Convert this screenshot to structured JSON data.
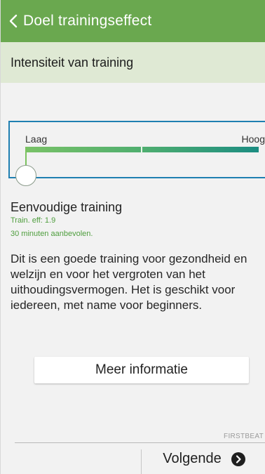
{
  "header": {
    "title": "Doel trainingseffect",
    "back_icon": "chevron-left-icon",
    "color": "#6aa84f"
  },
  "subheader": {
    "text": "Intensiteit van training",
    "color": "#dfe9d4"
  },
  "slider": {
    "low_label": "Laag",
    "high_label": "Hoog",
    "level": 0.0,
    "accent": "#1f7fb1"
  },
  "result": {
    "title": "Eenvoudige training",
    "effect": "Train. eff: 1.9",
    "recommendation": "30 minuten aanbevolen.",
    "description": "Dit is een goede training voor gezondheid en welzijn en voor het vergroten van het uithoudingsvermogen. Het is geschikt voor iedereen, met name voor beginners.",
    "accent": "#4f9e3e"
  },
  "actions": {
    "more_info": "Meer informatie"
  },
  "brand": "FIRSTBEAT",
  "footer": {
    "next_label": "Volgende",
    "next_icon": "chevron-right-circle-icon"
  }
}
